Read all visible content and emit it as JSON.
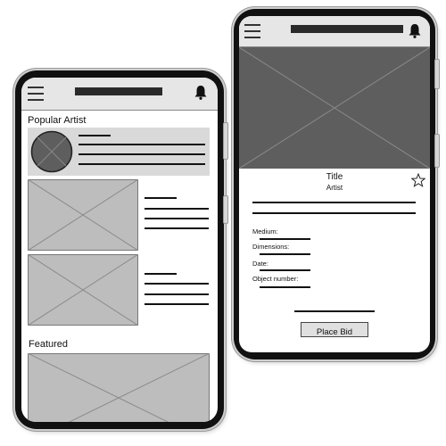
{
  "left_phone": {
    "section_popular": "Popular Artist",
    "section_featured": "Featured"
  },
  "right_phone": {
    "artwork_title": "Title",
    "artwork_artist": "Artist",
    "fields": {
      "medium": "Medium:",
      "dimensions": "Dimensions:",
      "date": "Date:",
      "object_number": "Object number:"
    },
    "place_bid_label": "Place Bid"
  },
  "icons": {
    "menu": "hamburger-menu-icon",
    "notifications": "bell-icon",
    "favorite": "star-outline-icon",
    "image_placeholder": "image-placeholder-x-icon"
  },
  "colors": {
    "frame": "#111111",
    "topbar": "#e6e6e6",
    "placeholder_light": "#bdbdbd",
    "placeholder_dark": "#5e5e5e",
    "button": "#e0e0e0"
  }
}
